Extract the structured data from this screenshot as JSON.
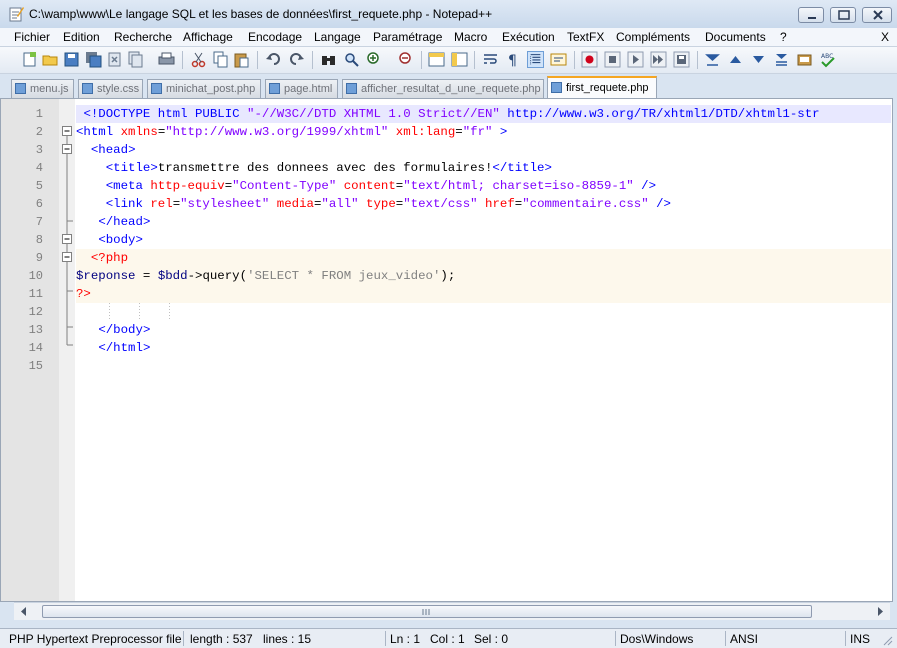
{
  "window": {
    "title": "C:\\wamp\\www\\Le langage SQL et les bases de données\\first_requete.php - Notepad++"
  },
  "menu": {
    "items": [
      "Fichier",
      "Edition",
      "Recherche",
      "Affichage",
      "Encodage",
      "Langage",
      "Paramétrage",
      "Macro",
      "Exécution",
      "TextFX",
      "Compléments",
      "Documents",
      "?"
    ],
    "close": "X"
  },
  "tabs": [
    {
      "label": "menu.js",
      "active": false
    },
    {
      "label": "style.css",
      "active": false
    },
    {
      "label": "minichat_post.php",
      "active": false
    },
    {
      "label": "page.html",
      "active": false
    },
    {
      "label": "afficher_resultat_d_une_requete.php",
      "active": false
    },
    {
      "label": "first_requete.php",
      "active": true
    }
  ],
  "editor": {
    "line_numbers": [
      "1",
      "2",
      "3",
      "4",
      "5",
      "6",
      "7",
      "8",
      "9",
      "10",
      "11",
      "12",
      "13",
      "14",
      "15"
    ],
    "lines": [
      " <!DOCTYPE html PUBLIC \"-//W3C//DTD XHTML 1.0 Strict//EN\" \"http://www.w3.org/TR/xhtml1/DTD/xhtml1-str",
      "<html xmlns=\"http://www.w3.org/1999/xhtml\" xml:lang=\"fr\" >",
      "  <head>",
      "    <title>transmettre des donnees avec des formulaires!</title>",
      "    <meta http-equiv=\"Content-Type\" content=\"text/html; charset=iso-8859-1\" />",
      "    <link rel=\"stylesheet\" media=\"all\" type=\"text/css\" href=\"commentaire.css\" />",
      "   </head>",
      "   <body>",
      "  <?php",
      "$reponse = $bdd->query('SELECT * FROM jeux_video');",
      "?>",
      "",
      "   </body>",
      "   </html>",
      ""
    ],
    "fold_markers": [
      "",
      "minus",
      "minus",
      "",
      "",
      "",
      "",
      "minus",
      "minus",
      "",
      "",
      "",
      "",
      "end",
      ""
    ]
  },
  "status": {
    "language": "PHP Hypertext Preprocessor file",
    "length": "length : 537",
    "lines": "lines : 15",
    "ln": "Ln : 1",
    "col": "Col : 1",
    "sel": "Sel : 0",
    "eol": "Dos\\Windows",
    "encoding": "ANSI",
    "mode": "INS"
  },
  "colors": {
    "tag": "#0000ff",
    "attribute": "#ff0000",
    "string": "#8000ff",
    "php_delimiter": "#ff0000",
    "current_line": "#e8e8ff",
    "php_block": "#fdf8ec"
  },
  "toolbar_icons": [
    "new-file-icon",
    "open-file-icon",
    "save-icon",
    "save-all-icon",
    "close-icon",
    "close-all-icon",
    "print-icon",
    "cut-icon",
    "copy-icon",
    "paste-icon",
    "undo-icon",
    "redo-icon",
    "find-icon",
    "find-next-icon",
    "replace-icon",
    "zoom-in-icon",
    "zoom-out-icon",
    "sync-vertical-icon",
    "sync-horizontal-icon",
    "word-wrap-icon",
    "show-all-chars-icon",
    "indent-guide-icon",
    "user-lang-icon",
    "record-macro-icon",
    "stop-macro-icon",
    "play-macro-icon",
    "play-multiple-icon",
    "save-macro-icon",
    "trim-icon",
    "previous-icon",
    "next-icon",
    "sort-icon",
    "ftp-icon",
    "spellcheck-icon"
  ]
}
